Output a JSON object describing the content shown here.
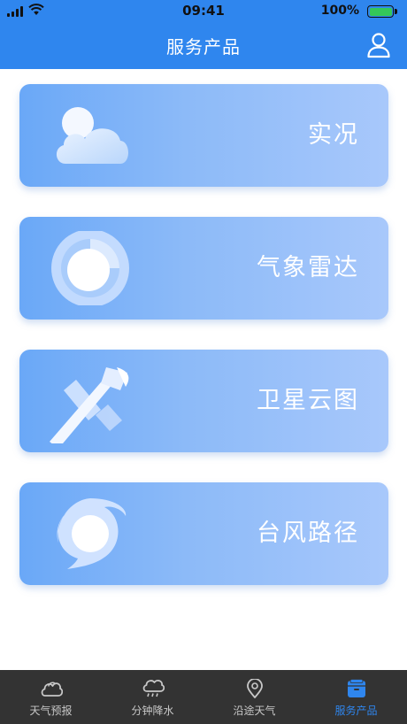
{
  "status_bar": {
    "time": "09:41",
    "battery_percent": "100%",
    "battery_level": 1.0
  },
  "header": {
    "title": "服务产品",
    "background": "#2f86ee",
    "right_icon": "user-icon"
  },
  "cards": [
    {
      "label": "实况",
      "icon": "cloud-sun-icon"
    },
    {
      "label": "气象雷达",
      "icon": "radar-icon"
    },
    {
      "label": "卫星云图",
      "icon": "satellite-icon"
    },
    {
      "label": "台风路径",
      "icon": "typhoon-icon"
    }
  ],
  "tabbar": {
    "active_color": "#2f86ee",
    "items": [
      {
        "label": "天气预报",
        "icon": "cloud-icon",
        "active": false
      },
      {
        "label": "分钟降水",
        "icon": "rain-cloud-icon",
        "active": false
      },
      {
        "label": "沿途天气",
        "icon": "location-pin-icon",
        "active": false
      },
      {
        "label": "服务产品",
        "icon": "service-box-icon",
        "active": true
      }
    ]
  }
}
